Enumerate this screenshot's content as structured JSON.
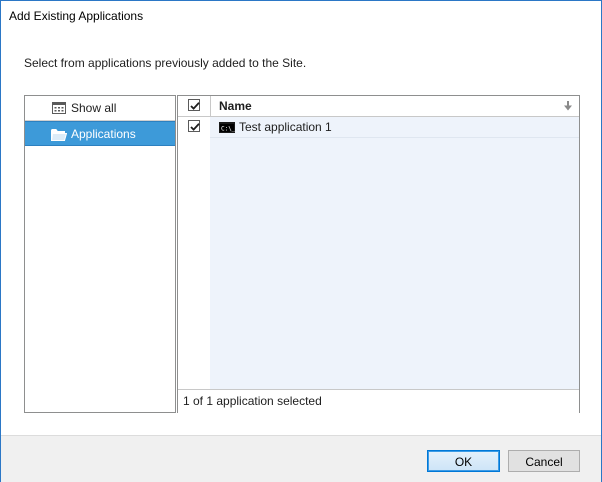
{
  "window": {
    "title": "Add Existing Applications"
  },
  "instruction": "Select from applications previously added to the Site.",
  "filters": [
    {
      "label": "Show all",
      "icon": "grid-list-icon",
      "selected": false
    },
    {
      "label": "Applications",
      "icon": "folder-icon",
      "selected": true
    }
  ],
  "grid": {
    "header": {
      "name_label": "Name",
      "all_checked": true
    },
    "rows": [
      {
        "name": "Test application 1",
        "checked": true,
        "icon": "console-app-icon"
      }
    ],
    "footer": "1 of 1 application selected"
  },
  "buttons": {
    "ok": "OK",
    "cancel": "Cancel"
  },
  "colors": {
    "accent": "#3d9ad9",
    "window_border": "#2b77c6",
    "row_bg": "#eef3fb"
  }
}
